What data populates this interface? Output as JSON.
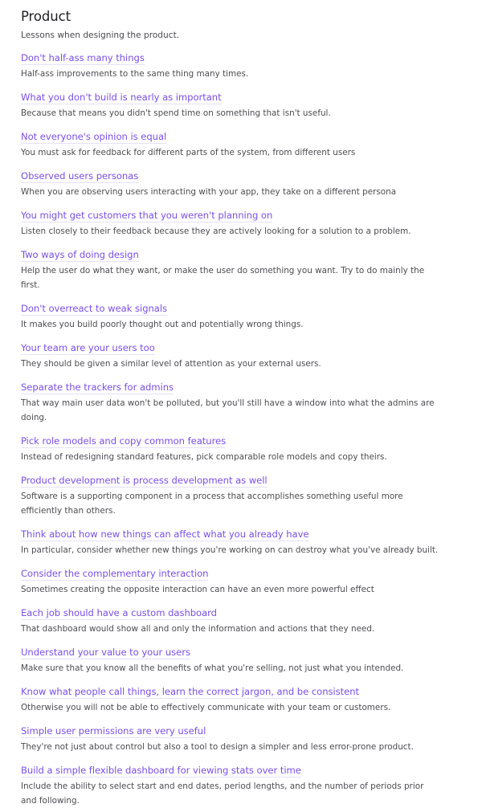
{
  "page": {
    "title": "Product",
    "subtitle": "Lessons when designing the product."
  },
  "colors": {
    "link": "#7a4fe8",
    "heading": "#1f1f24",
    "body_text": "#4d4d52"
  },
  "lessons": [
    {
      "title": "Don't half-ass many things",
      "description": "Half-ass improvements to the same thing many times."
    },
    {
      "title": "What you don't build is nearly as important",
      "description": "Because that means you didn't spend time on something that isn't useful."
    },
    {
      "title": "Not everyone's opinion is equal",
      "description": "You must ask for feedback for different parts of the system, from different users"
    },
    {
      "title": "Observed users personas",
      "description": "When you are observing users interacting with your app, they take on a different persona"
    },
    {
      "title": "You might get customers that you weren't planning on",
      "description": "Listen closely to their feedback because they are actively looking for a solution to a problem."
    },
    {
      "title": "Two ways of doing design",
      "description": "Help the user do what they want, or make the user do something you want. Try to do mainly the first."
    },
    {
      "title": "Don't overreact to weak signals",
      "description": "It makes you build poorly thought out and potentially wrong things."
    },
    {
      "title": "Your team are your users too",
      "description": "They should be given a similar level of attention as your external users."
    },
    {
      "title": "Separate the trackers for admins",
      "description": "That way main user data won't be polluted, but you'll still have a window into what the admins are doing."
    },
    {
      "title": "Pick role models and copy common features",
      "description": "Instead of redesigning standard features, pick comparable role models and copy theirs."
    },
    {
      "title": "Product development is process development as well",
      "description": "Software is a supporting component in a process that accomplishes something useful more efficiently than others."
    },
    {
      "title": "Think about how new things can affect what you already have",
      "description": "In particular, consider whether new things you're working on can destroy what you've already built."
    },
    {
      "title": "Consider the complementary interaction",
      "description": "Sometimes creating the opposite interaction can have an even more powerful effect"
    },
    {
      "title": "Each job should have a custom dashboard",
      "description": "That dashboard would show all and only the information and actions that they need."
    },
    {
      "title": "Understand your value to your users",
      "description": "Make sure that you know all the benefits of what you're selling, not just what you intended."
    },
    {
      "title": "Know what people call things, learn the correct jargon, and be consistent",
      "description": "Otherwise you will not be able to effectively communicate with your team or customers."
    },
    {
      "title": "Simple user permissions are very useful",
      "description": "They're not just about control but also a tool to design a simpler and less error-prone product."
    },
    {
      "title": "Build a simple flexible dashboard for viewing stats over time",
      "description": "Include the ability to select start and end dates, period lengths, and the number of periods prior and following."
    }
  ]
}
